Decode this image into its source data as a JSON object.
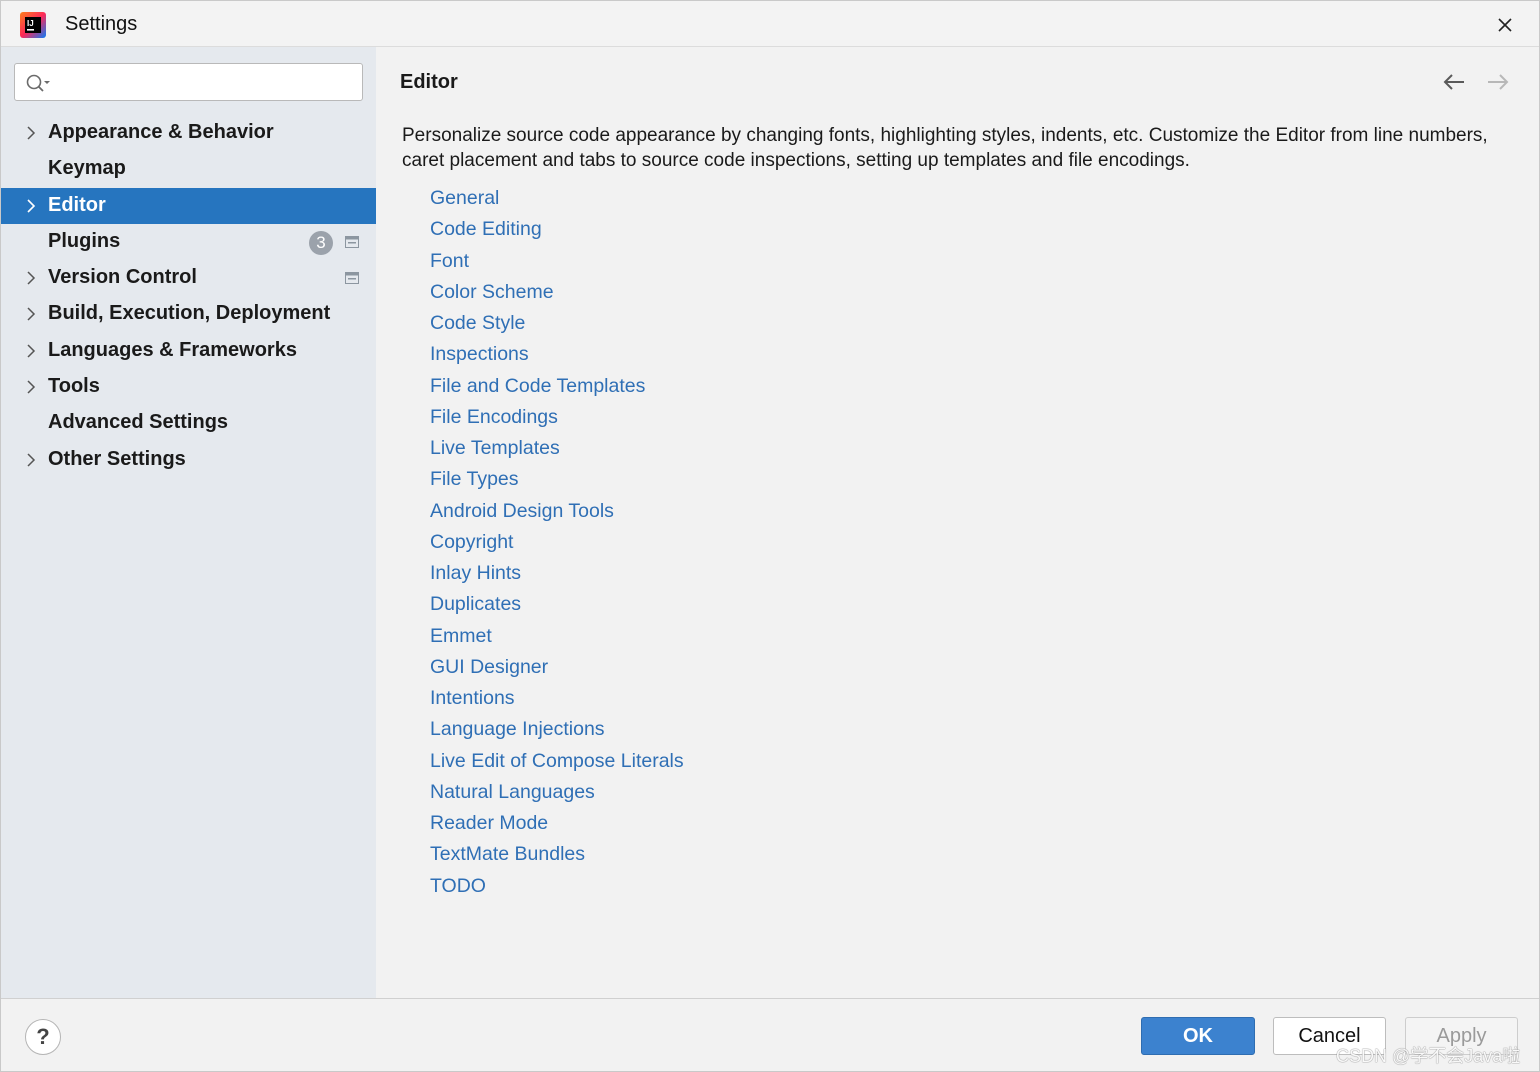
{
  "window": {
    "title": "Settings"
  },
  "search": {
    "value": "",
    "placeholder": ""
  },
  "sidebar": {
    "items": [
      {
        "label": "Appearance & Behavior",
        "expandable": true,
        "selected": false
      },
      {
        "label": "Keymap",
        "expandable": false,
        "selected": false
      },
      {
        "label": "Editor",
        "expandable": true,
        "selected": true
      },
      {
        "label": "Plugins",
        "expandable": false,
        "selected": false,
        "badge": "3",
        "project_icon": true
      },
      {
        "label": "Version Control",
        "expandable": true,
        "selected": false,
        "project_icon": true
      },
      {
        "label": "Build, Execution, Deployment",
        "expandable": true,
        "selected": false
      },
      {
        "label": "Languages & Frameworks",
        "expandable": true,
        "selected": false
      },
      {
        "label": "Tools",
        "expandable": true,
        "selected": false
      },
      {
        "label": "Advanced Settings",
        "expandable": false,
        "selected": false
      },
      {
        "label": "Other Settings",
        "expandable": true,
        "selected": false
      }
    ]
  },
  "content": {
    "title": "Editor",
    "description": "Personalize source code appearance by changing fonts, highlighting styles, indents, etc. Customize the Editor from line numbers, caret placement and tabs to source code inspections, setting up templates and file encodings.",
    "links": [
      "General",
      "Code Editing",
      "Font",
      "Color Scheme",
      "Code Style",
      "Inspections",
      "File and Code Templates",
      "File Encodings",
      "Live Templates",
      "File Types",
      "Android Design Tools",
      "Copyright",
      "Inlay Hints",
      "Duplicates",
      "Emmet",
      "GUI Designer",
      "Intentions",
      "Language Injections",
      "Live Edit of Compose Literals",
      "Natural Languages",
      "Reader Mode",
      "TextMate Bundles",
      "TODO"
    ]
  },
  "footer": {
    "help": "?",
    "ok_label": "OK",
    "cancel_label": "Cancel",
    "apply_label": "Apply",
    "watermark": "CSDN @学不会Java啦"
  },
  "colors": {
    "selection": "#2675bf",
    "link": "#2f6fb5",
    "sidebar_bg": "#e5e9ee",
    "content_bg": "#f2f2f2",
    "ok_button": "#3c82cf"
  }
}
